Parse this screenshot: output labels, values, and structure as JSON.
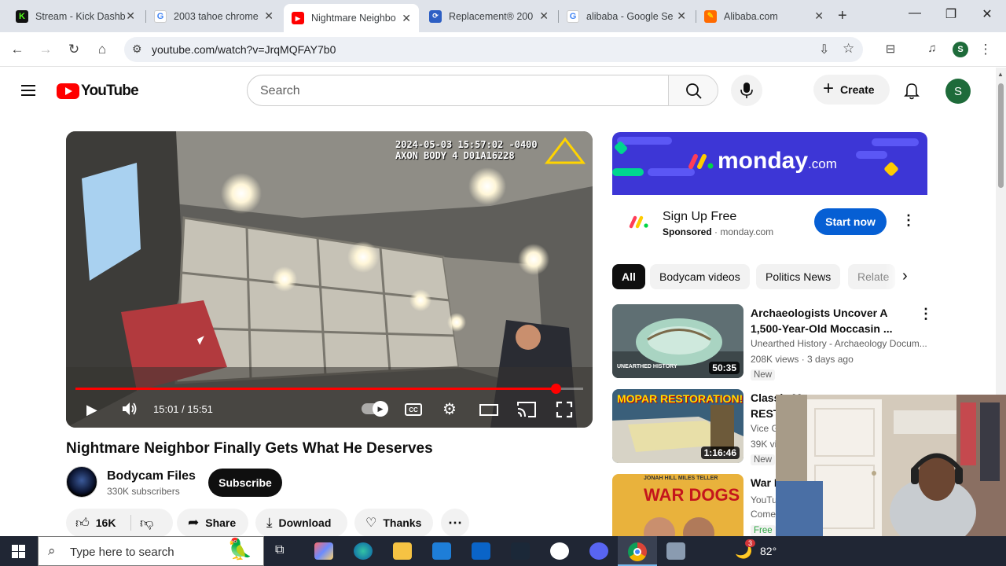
{
  "browser": {
    "tabs": [
      {
        "label": "Stream - Kick Dashb",
        "favicon": "kick-icon",
        "active": false
      },
      {
        "label": "2003 tahoe chrome",
        "favicon": "google-icon",
        "active": false
      },
      {
        "label": "Nightmare Neighbo",
        "favicon": "youtube-icon",
        "active": true
      },
      {
        "label": "Replacement® 200",
        "favicon": "autozone-icon",
        "active": false
      },
      {
        "label": "alibaba - Google Se",
        "favicon": "google-icon",
        "active": false
      },
      {
        "label": "Alibaba.com",
        "favicon": "alibaba-icon",
        "active": false
      }
    ],
    "url": "youtube.com/watch?v=JrqMQFAY7b0",
    "profile_initial": "S"
  },
  "youtube": {
    "logo_text": "YouTube",
    "search_placeholder": "Search",
    "create_label": "Create",
    "avatar_initial": "S"
  },
  "player": {
    "time": "15:01 / 15:51",
    "progress": 0.946,
    "overlay_line1": "2024-05-03 15:57:02 -0400",
    "overlay_line2": "AXON BODY 4 D01A16228"
  },
  "video": {
    "title": "Nightmare Neighbor Finally Gets What He Deserves",
    "channel": "Bodycam Files",
    "subscribers": "330K subscribers",
    "subscribe_label": "Subscribe",
    "likes": "16K",
    "share_label": "Share",
    "download_label": "Download",
    "thanks_label": "Thanks"
  },
  "ad": {
    "brand": "monday",
    "brand_suffix": ".com",
    "title": "Sign Up Free",
    "sponsored": "Sponsored",
    "domain": "monday.com",
    "cta": "Start now"
  },
  "chips": [
    "All",
    "Bodycam videos",
    "Politics News",
    "Relate"
  ],
  "recommendations": [
    {
      "title": "Archaeologists Uncover A 1,500-Year-Old Moccasin ...",
      "channel": "Unearthed History - Archaeology Docum...",
      "meta": "208K views · 3 days ago",
      "badge": "New",
      "duration": "50:35",
      "thumb_text": "UNEARTHED HISTORY"
    },
    {
      "title": "Classic Mopar RESTORATION! Incre...",
      "channel": "Vice G...",
      "meta": "39K vi...",
      "badge": "New",
      "duration": "1:16:46",
      "thumb_text": "MOPAR RESTORATION!"
    },
    {
      "title": "War D...",
      "channel": "YouTu...",
      "meta": "Come...",
      "badge": "Free",
      "duration": "",
      "thumb_text": "WAR DOGS",
      "thumb_names": "JONAH HILL  MILES TELLER"
    }
  ],
  "taskbar": {
    "search_placeholder": "Type here to search",
    "temperature": "82°",
    "notification_count": "3"
  },
  "colors": {
    "youtube_red": "#ff0000",
    "ad_blue": "#065fd4",
    "monday_purple": "#3d36d6",
    "channel_green": "#1e6b3a"
  }
}
